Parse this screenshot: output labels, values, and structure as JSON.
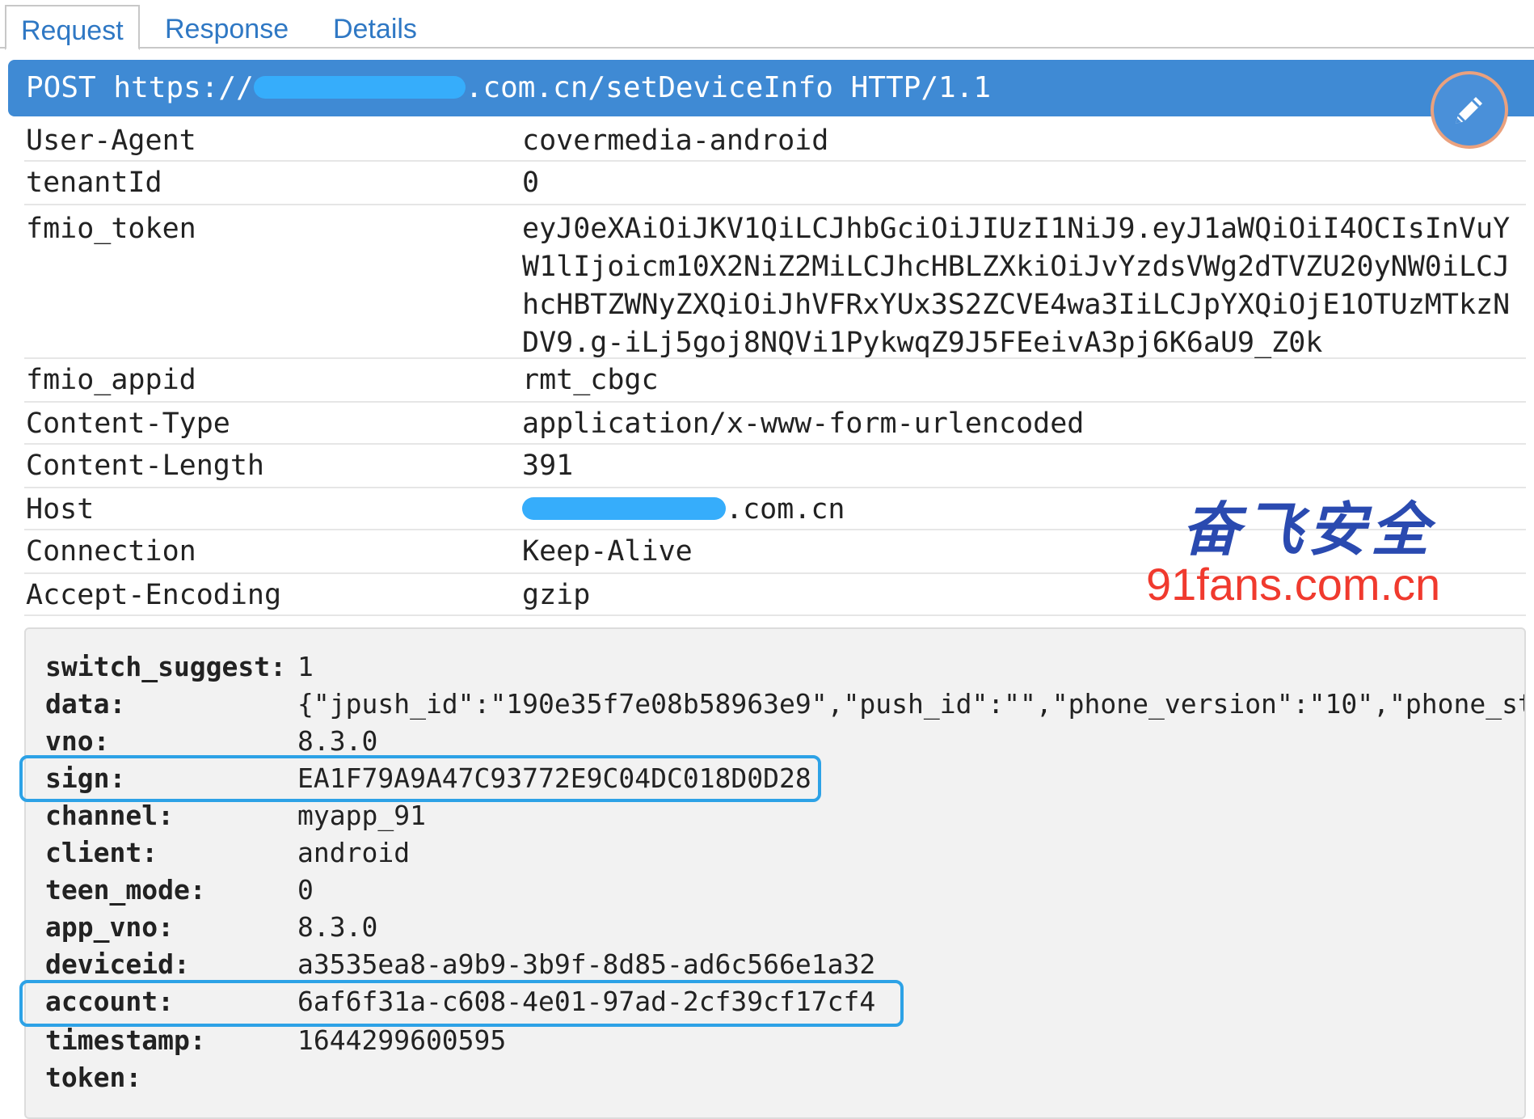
{
  "tabs": [
    {
      "label": "Request",
      "active": true
    },
    {
      "label": "Response",
      "active": false
    },
    {
      "label": "Details",
      "active": false
    }
  ],
  "request_line": {
    "method": "POST",
    "url_prefix": "https://",
    "url_suffix": ".com.cn/setDeviceInfo",
    "protocol": "HTTP/1.1"
  },
  "edit_button": {
    "icon": "pencil-icon"
  },
  "headers": [
    {
      "key": "User-Agent",
      "value": "covermedia-android"
    },
    {
      "key": "tenantId",
      "value": "0"
    },
    {
      "key": "fmio_token",
      "value": "eyJ0eXAiOiJKV1QiLCJhbGciOiJIUzI1NiJ9.eyJ1aWQiOiI4OCIsInVuYW1lIjoicm10X2NiZ2MiLCJhcHBLZXkiOiJvYzdsVWg2dTVZU20yNW0iLCJhcHBTZWNyZXQiOiJhVFRxYUx3S2ZCVE4wa3IiLCJpYXQiOjE1OTUzMTkzNDV9.g-iLj5goj8NQVi1PykwqZ9J5FEeivA3pj6K6aU9_Z0k"
    },
    {
      "key": "fmio_appid",
      "value": "rmt_cbgc"
    },
    {
      "key": "Content-Type",
      "value": "application/x-www-form-urlencoded"
    },
    {
      "key": "Content-Length",
      "value": "391"
    },
    {
      "key": "Host",
      "value": ".com.cn"
    },
    {
      "key": "Connection",
      "value": "Keep-Alive"
    },
    {
      "key": "Accept-Encoding",
      "value": "gzip"
    }
  ],
  "watermark": {
    "chinese": "奋飞安全",
    "url": "91fans.com.cn"
  },
  "body_params": [
    {
      "key": "switch_suggest:",
      "value": "1"
    },
    {
      "key": "data:",
      "value": "{\"jpush_id\":\"190e35f7e08b58963e9\",\"push_id\":\"\",\"phone_version\":\"10\",\"phone_sty"
    },
    {
      "key": "vno:",
      "value": "8.3.0"
    },
    {
      "key": "sign:",
      "value": "EA1F79A9A47C93772E9C04DC018D0D28"
    },
    {
      "key": "channel:",
      "value": "myapp_91"
    },
    {
      "key": "client:",
      "value": "android"
    },
    {
      "key": "teen_mode:",
      "value": "0"
    },
    {
      "key": "app_vno:",
      "value": "8.3.0"
    },
    {
      "key": "deviceid:",
      "value": "a3535ea8-a9b9-3b9f-8d85-ad6c566e1a32"
    },
    {
      "key": "account:",
      "value": "6af6f31a-c608-4e01-97ad-2cf39cf17cf4"
    },
    {
      "key": "timestamp:",
      "value": "1644299600595"
    },
    {
      "key": "token:",
      "value": ""
    }
  ],
  "colors": {
    "tab_text": "#2f78c4",
    "request_bar": "#3f8ad4",
    "highlight": "#2da2e6",
    "redaction": "#36adfb"
  }
}
